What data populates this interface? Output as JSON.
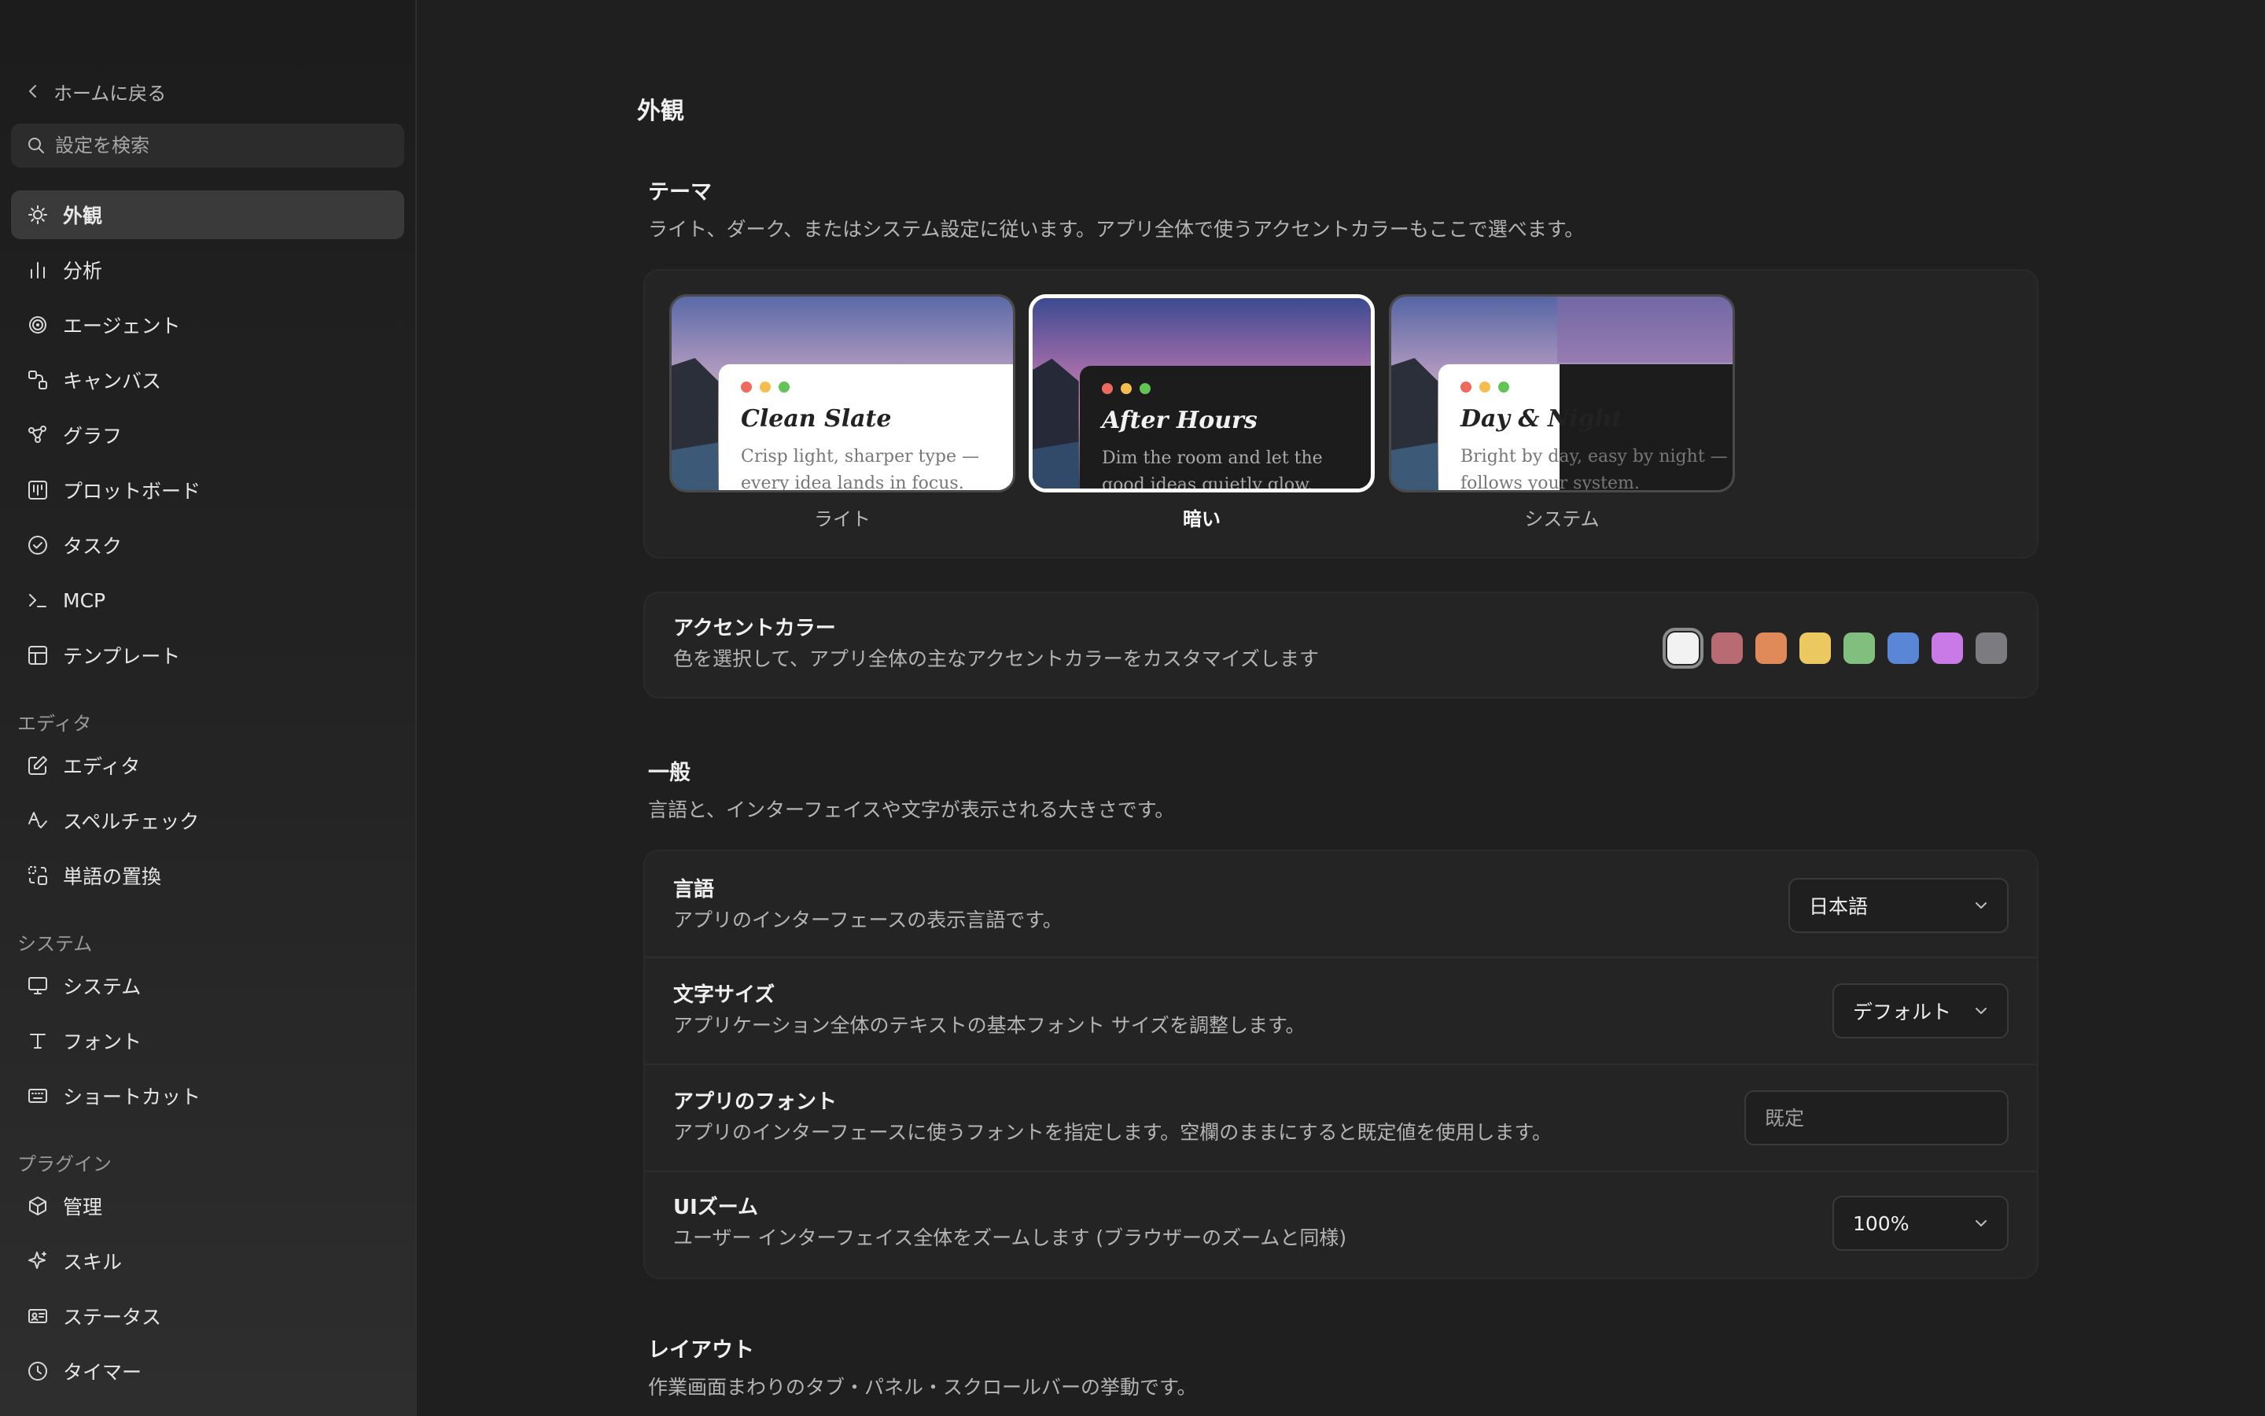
{
  "sidebar": {
    "back_label": "ホームに戻る",
    "search_placeholder": "設定を検索",
    "items": [
      {
        "label": "外観"
      },
      {
        "label": "分析"
      },
      {
        "label": "エージェント"
      },
      {
        "label": "キャンバス"
      },
      {
        "label": "グラフ"
      },
      {
        "label": "プロットボード"
      },
      {
        "label": "タスク"
      },
      {
        "label": "MCP"
      },
      {
        "label": "テンプレート"
      }
    ],
    "editor_section": "エディタ",
    "editor_items": [
      {
        "label": "エディタ"
      },
      {
        "label": "スペルチェック"
      },
      {
        "label": "単語の置換"
      }
    ],
    "system_section": "システム",
    "system_items": [
      {
        "label": "システム"
      },
      {
        "label": "フォント"
      },
      {
        "label": "ショートカット"
      }
    ],
    "plugin_section": "プラグイン",
    "plugin_items": [
      {
        "label": "管理"
      },
      {
        "label": "スキル"
      },
      {
        "label": "ステータス"
      },
      {
        "label": "タイマー"
      }
    ]
  },
  "main": {
    "page_title": "外観",
    "theme": {
      "title": "テーマ",
      "description": "ライト、ダーク、またはシステム設定に従います。アプリ全体で使うアクセントカラーもここで選べます。",
      "options": [
        {
          "name": "Clean Slate",
          "subtitle": "Crisp light, sharper type — every idea lands in focus.",
          "label": "ライト",
          "selected": false
        },
        {
          "name": "After Hours",
          "subtitle": "Dim the room and let the good ideas quietly glow.",
          "label": "暗い",
          "selected": true
        },
        {
          "name": "Day & Night",
          "subtitle": "Bright by day, easy by night — follows your system.",
          "label": "システム",
          "selected": false
        }
      ]
    },
    "accent": {
      "title": "アクセントカラー",
      "description": "色を選択して、アプリ全体の主なアクセントカラーをカスタマイズします",
      "colors": [
        "#f2f2f2",
        "#b86b72",
        "#e08a5a",
        "#ecc860",
        "#80bf7d",
        "#5a86d6",
        "#c87ae6",
        "#7b7b80"
      ],
      "selected_index": 0
    },
    "general": {
      "title": "一般",
      "description": "言語と、インターフェイスや文字が表示される大きさです。",
      "language": {
        "title": "言語",
        "description": "アプリのインターフェースの表示言語です。",
        "value": "日本語"
      },
      "font_size": {
        "title": "文字サイズ",
        "description": "アプリケーション全体のテキストの基本フォント サイズを調整します。",
        "value": "デフォルト"
      },
      "app_font": {
        "title": "アプリのフォント",
        "description": "アプリのインターフェースに使うフォントを指定します。空欄のままにすると既定値を使用します。",
        "placeholder": "既定"
      },
      "ui_zoom": {
        "title": "UIズーム",
        "description": "ユーザー インターフェイス全体をズームします (ブラウザーのズームと同様)",
        "value": "100%"
      }
    },
    "layout": {
      "title": "レイアウト",
      "description": "作業画面まわりのタブ・パネル・スクロールバーの挙動です。"
    }
  }
}
